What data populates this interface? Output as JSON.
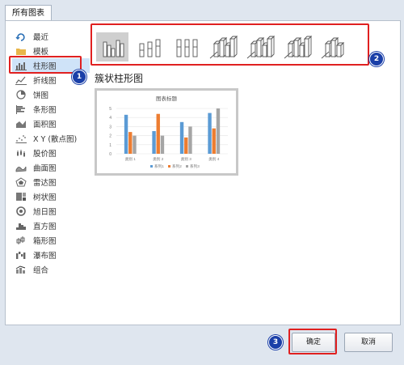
{
  "dialog": {
    "tab_label": "所有图表"
  },
  "sidebar": {
    "items": [
      {
        "label": "最近",
        "icon": "recent-icon"
      },
      {
        "label": "模板",
        "icon": "folder-icon"
      },
      {
        "label": "柱形图",
        "icon": "column-chart-icon",
        "selected": true
      },
      {
        "label": "折线图",
        "icon": "line-chart-icon"
      },
      {
        "label": "饼图",
        "icon": "pie-chart-icon"
      },
      {
        "label": "条形图",
        "icon": "bar-chart-icon"
      },
      {
        "label": "面积图",
        "icon": "area-chart-icon"
      },
      {
        "label": "X Y (散点图)",
        "icon": "scatter-chart-icon"
      },
      {
        "label": "股价图",
        "icon": "stock-chart-icon"
      },
      {
        "label": "曲面图",
        "icon": "surface-chart-icon"
      },
      {
        "label": "雷达图",
        "icon": "radar-chart-icon"
      },
      {
        "label": "树状图",
        "icon": "treemap-chart-icon"
      },
      {
        "label": "旭日图",
        "icon": "sunburst-chart-icon"
      },
      {
        "label": "直方图",
        "icon": "histogram-chart-icon"
      },
      {
        "label": "箱形图",
        "icon": "box-whisker-chart-icon"
      },
      {
        "label": "瀑布图",
        "icon": "waterfall-chart-icon"
      },
      {
        "label": "组合",
        "icon": "combo-chart-icon"
      }
    ]
  },
  "subtypes": [
    {
      "icon": "clustered-column-icon",
      "selected": true
    },
    {
      "icon": "stacked-column-icon"
    },
    {
      "icon": "percent-stacked-column-icon"
    },
    {
      "icon": "3d-clustered-column-icon"
    },
    {
      "icon": "3d-stacked-column-icon"
    },
    {
      "icon": "3d-percent-stacked-column-icon"
    },
    {
      "icon": "3d-column-icon"
    }
  ],
  "selected_type_title": "簇状柱形图",
  "chart_data": {
    "type": "bar",
    "title": "图表标题",
    "categories": [
      "类别 1",
      "类别 2",
      "类别 3",
      "类别 4"
    ],
    "series": [
      {
        "name": "系列1",
        "values": [
          4.3,
          2.5,
          3.5,
          4.5
        ],
        "color": "#5b9bd5"
      },
      {
        "name": "系列2",
        "values": [
          2.4,
          4.4,
          1.8,
          2.8
        ],
        "color": "#ed7d31"
      },
      {
        "name": "系列3",
        "values": [
          2.0,
          2.0,
          3.0,
          5.0
        ],
        "color": "#a5a5a5"
      }
    ],
    "ylim": [
      0,
      5
    ],
    "yticks": [
      "0",
      "1",
      "2",
      "3",
      "4",
      "5"
    ],
    "legend": "bottom"
  },
  "annotations": {
    "badge1": "1",
    "badge2": "2",
    "badge3": "3"
  },
  "buttons": {
    "ok_label": "确定",
    "cancel_label": "取消"
  },
  "accent": {
    "callout": "#e02020",
    "badge": "#1a3fa8",
    "selection": "#cfe3f8"
  }
}
